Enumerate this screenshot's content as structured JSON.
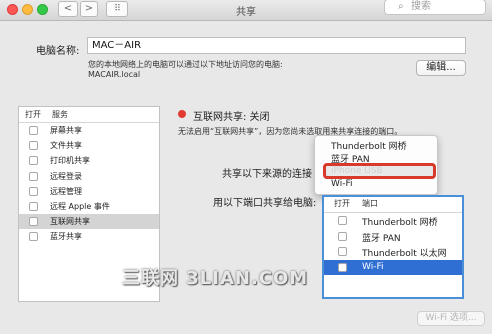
{
  "window": {
    "title": "共享",
    "search_placeholder": "搜索",
    "nav_back": "<",
    "nav_forward": ">",
    "grid_icon": "⠿"
  },
  "computer": {
    "name_label": "电脑名称:",
    "name_value": "MAC－AIR",
    "desc_line1": "您的本地网络上的电脑可以通过以下地址访问您的电脑:",
    "desc_line2": "MACAIR.local",
    "edit_button": "编辑..."
  },
  "services": {
    "header_on": "打开",
    "header_service": "服务",
    "items": [
      {
        "label": "屏幕共享",
        "selected": false
      },
      {
        "label": "文件共享",
        "selected": false
      },
      {
        "label": "打印机共享",
        "selected": false
      },
      {
        "label": "远程登录",
        "selected": false
      },
      {
        "label": "远程管理",
        "selected": false
      },
      {
        "label": "远程 Apple 事件",
        "selected": false
      },
      {
        "label": "互联网共享",
        "selected": true
      },
      {
        "label": "蓝牙共享",
        "selected": false
      }
    ]
  },
  "detail": {
    "status_title": "互联网共享: 关闭",
    "status_color": "#e23a32",
    "status_desc": "无法启用“互联网共享”，因为您尚未选取用来共享连接的端口。",
    "share_from_label": "共享以下来源的连接",
    "share_to_label": "用以下端口共享给电脑:",
    "source_menu": {
      "items": [
        "Thunderbolt 网桥",
        "蓝牙 PAN",
        "iPhone USB",
        "Wi-Fi"
      ],
      "highlighted": "iPhone USB"
    },
    "ports": {
      "header_on": "打开",
      "header_port": "端口",
      "items": [
        {
          "label": "Thunderbolt 网桥",
          "selected": false
        },
        {
          "label": "蓝牙 PAN",
          "selected": false
        },
        {
          "label": "Thunderbolt 以太网",
          "selected": false
        },
        {
          "label": "Wi-Fi",
          "selected": true
        }
      ]
    },
    "wifi_options_button": "Wi-Fi 选项..."
  },
  "watermark": "三联网 3LIAN.COM",
  "colors": {
    "highlight_box": "#d73a2a",
    "port_selection": "#2f6fd3"
  }
}
